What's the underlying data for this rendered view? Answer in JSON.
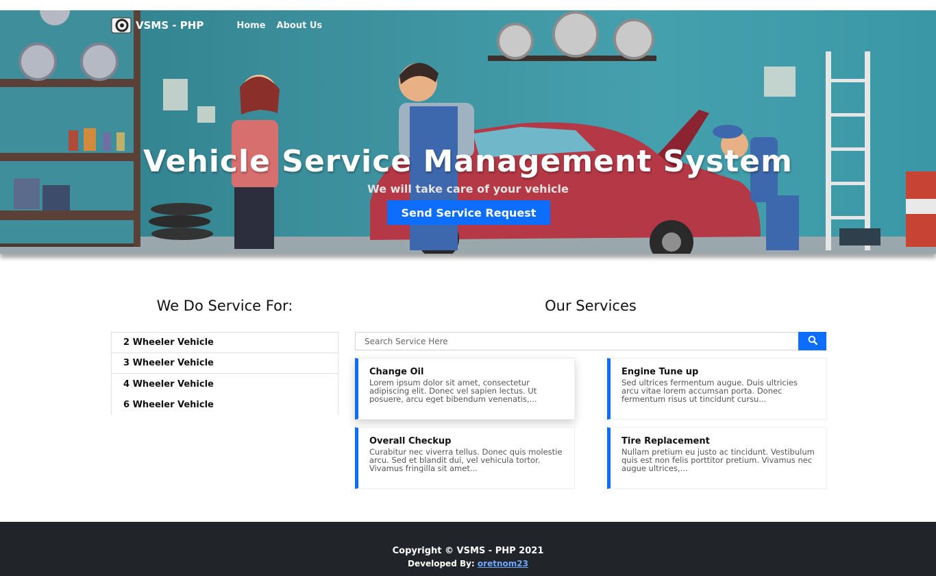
{
  "navbar": {
    "brand": "VSMS - PHP",
    "links": [
      "Home",
      "About Us"
    ]
  },
  "hero": {
    "title": "Vehicle Service Management System",
    "subtitle": "We will take care of your vehicle",
    "button": "Send Service Request"
  },
  "vehicles": {
    "title": "We Do Service For:",
    "items": [
      "2 Wheeler Vehicle",
      "3 Wheeler Vehicle",
      "4 Wheeler Vehicle",
      "6 Wheeler Vehicle"
    ]
  },
  "services": {
    "title": "Our Services",
    "search_placeholder": "Search Service Here",
    "items": [
      {
        "title": "Change Oil",
        "text": "Lorem ipsum dolor sit amet, consectetur adipiscing elit. Donec vel sapien lectus. Ut posuere, arcu eget bibendum venenatis,..."
      },
      {
        "title": "Engine Tune up",
        "text": "Sed ultrices fermentum augue. Duis ultricies arcu vitae lorem accumsan porta. Donec fermentum risus ut tincidunt cursu..."
      },
      {
        "title": "Overall Checkup",
        "text": "Curabitur nec viverra tellus. Donec quis molestie arcu. Sed et blandit dui, vel vehicula tortor. Vivamus fringilla sit amet..."
      },
      {
        "title": "Tire Replacement",
        "text": "Nullam pretium eu justo ac tincidunt. Vestibulum quis est non felis porttitor pretium. Vivamus nec augue ultrices,..."
      }
    ]
  },
  "footer": {
    "copyright": "Copyright © VSMS - PHP 2021",
    "developed_label": "Developed By: ",
    "developer": "oretnom23"
  },
  "colors": {
    "primary": "#0d6efd",
    "footer_bg": "#212529",
    "hero_bg": "#3c8f9c"
  }
}
